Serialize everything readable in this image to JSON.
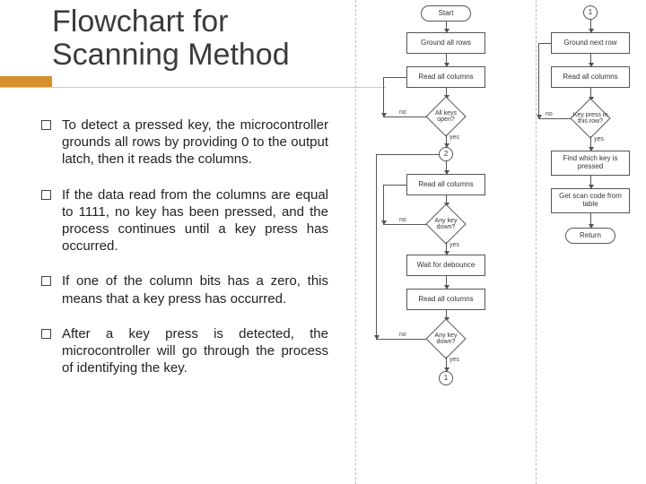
{
  "title": "Flowchart for Scanning Method",
  "bullets": [
    "To detect a pressed key, the microcontroller grounds all rows by providing 0 to the output latch, then it reads the columns.",
    "If the data read from the columns are equal to 1111, no key has been pressed, and the process continues until a key press has occurred.",
    "If one of the column bits has a zero, this means that a key press has occurred.",
    "After a key press is detected, the microcontroller will go through the process of identifying the key."
  ],
  "flow_left": {
    "start": "Start",
    "ground_all": "Ground all rows",
    "read1": "Read all columns",
    "dec1": "All keys open?",
    "dec1_no": "no",
    "dec1_yes": "yes",
    "conn_top": "2",
    "read2": "Read all columns",
    "dec2": "Any key down?",
    "dec2_no": "no",
    "dec2_yes": "yes",
    "wait": "Wait for debounce",
    "read3": "Read all columns",
    "dec3": "Any key down?",
    "dec3_no": "no",
    "dec3_yes": "yes",
    "conn_bottom": "1"
  },
  "flow_right": {
    "conn_top": "1",
    "ground_next": "Ground next row",
    "read": "Read all columns",
    "dec": "Key press in this row?",
    "dec_no": "no",
    "dec_yes": "yes",
    "find": "Find which key is pressed",
    "scan": "Get scan code from table",
    "ret": "Return"
  }
}
